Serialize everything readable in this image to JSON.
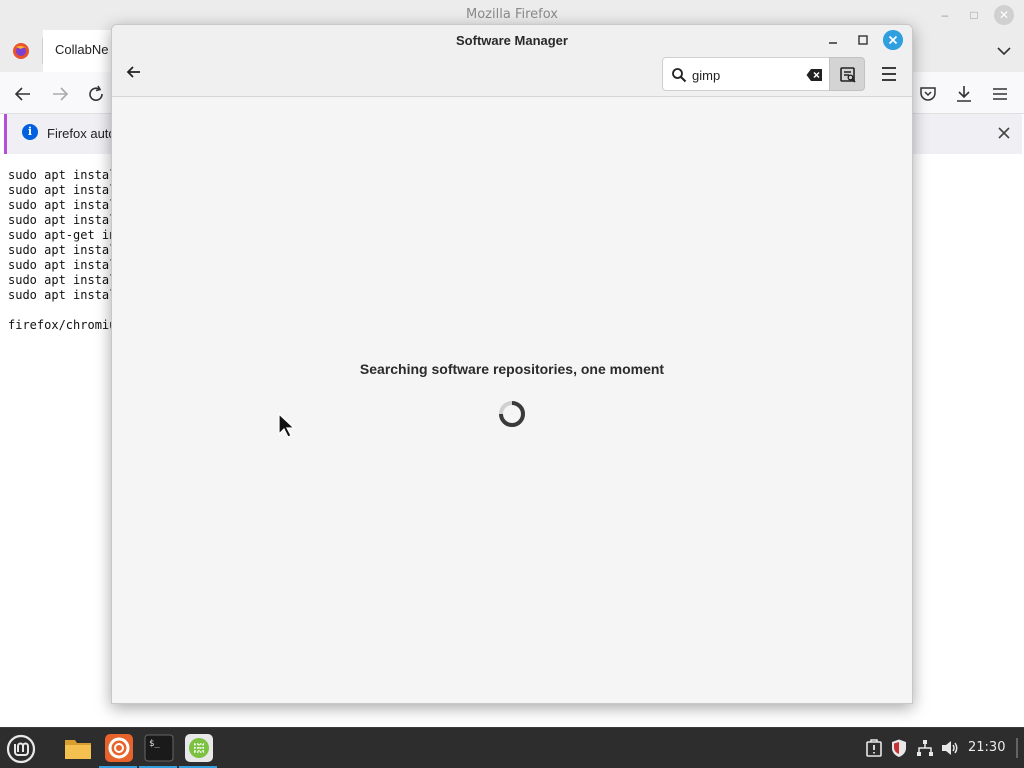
{
  "firefox": {
    "window_title": "Mozilla Firefox",
    "tab_label": "CollabNe",
    "notice_text": "Firefox auto",
    "page_lines": [
      "sudo apt instal",
      "sudo apt instal",
      "sudo apt instal",
      "sudo apt instal",
      "sudo apt-get in",
      "sudo apt instal",
      "sudo apt instal",
      "sudo apt instal",
      "sudo apt instal",
      "",
      "firefox/chromiu"
    ]
  },
  "software_manager": {
    "title": "Software Manager",
    "search": {
      "value": "gimp",
      "placeholder": ""
    },
    "status_text": "Searching software repositories, one moment",
    "accent_color": "#2f9fe0"
  },
  "taskbar": {
    "apps": [
      "files-icon",
      "firefox-icon",
      "terminal-icon",
      "software-manager-icon"
    ],
    "tray_icons": [
      "updates-icon",
      "shield-icon",
      "network-icon",
      "volume-icon"
    ],
    "clock": "21:30"
  }
}
